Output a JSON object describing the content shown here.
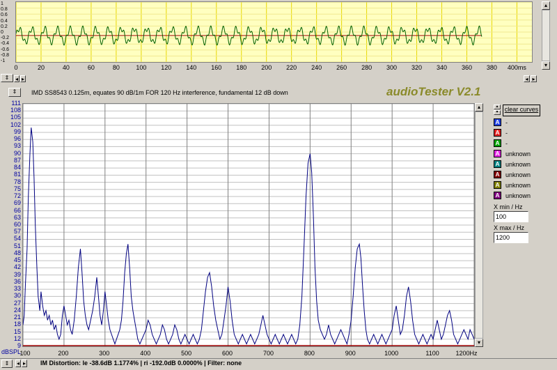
{
  "oscilloscope": {
    "y_labels": [
      "1",
      "0.8",
      "0.6",
      "0.4",
      "0.2",
      "0",
      "-0.2",
      "-0.4",
      "-0.6",
      "-0.8",
      "-1"
    ],
    "x_ticks": [
      "0",
      "20",
      "40",
      "60",
      "80",
      "100",
      "120",
      "140",
      "160",
      "180",
      "200",
      "220",
      "240",
      "260",
      "280",
      "300",
      "320",
      "340",
      "360",
      "380",
      "400ms"
    ],
    "x_max_ms": 400,
    "signal_end_ms": 372,
    "waveform_color": "#006000",
    "center_line_color": "#a00000"
  },
  "graph_title": "IMD SS8543 0.125m, equates 90 dB/1m FOR 120 Hz interference, fundamental 12 dB down",
  "app_logo": "audioTester V2.1",
  "chart_data": {
    "type": "line",
    "title": "",
    "xlabel": "Hz",
    "ylabel": "dBSPL",
    "xlim": [
      100,
      1200
    ],
    "ylim": [
      9,
      111
    ],
    "x_ticks": [
      "100",
      "200",
      "300",
      "400",
      "500",
      "600",
      "700",
      "800",
      "900",
      "1000",
      "1100",
      "1200Hz"
    ],
    "y_ticks": [
      "111",
      "108",
      "105",
      "102",
      "99",
      "96",
      "93",
      "90",
      "87",
      "84",
      "81",
      "78",
      "75",
      "72",
      "69",
      "66",
      "63",
      "60",
      "57",
      "54",
      "51",
      "48",
      "45",
      "42",
      "39",
      "36",
      "33",
      "30",
      "27",
      "24",
      "21",
      "18",
      "15",
      "12",
      "9"
    ],
    "series": [
      {
        "color": "#000080",
        "points": [
          [
            100,
            18
          ],
          [
            103,
            22
          ],
          [
            106,
            35
          ],
          [
            110,
            50
          ],
          [
            113,
            72
          ],
          [
            117,
            90
          ],
          [
            120,
            101
          ],
          [
            124,
            95
          ],
          [
            127,
            80
          ],
          [
            130,
            60
          ],
          [
            134,
            42
          ],
          [
            137,
            30
          ],
          [
            141,
            24
          ],
          [
            144,
            32
          ],
          [
            148,
            26
          ],
          [
            152,
            22
          ],
          [
            156,
            24
          ],
          [
            160,
            20
          ],
          [
            164,
            22
          ],
          [
            168,
            18
          ],
          [
            172,
            20
          ],
          [
            176,
            16
          ],
          [
            180,
            18
          ],
          [
            184,
            14
          ],
          [
            188,
            12
          ],
          [
            192,
            14
          ],
          [
            196,
            22
          ],
          [
            200,
            26
          ],
          [
            204,
            22
          ],
          [
            208,
            18
          ],
          [
            212,
            20
          ],
          [
            216,
            16
          ],
          [
            220,
            14
          ],
          [
            225,
            20
          ],
          [
            230,
            30
          ],
          [
            235,
            42
          ],
          [
            240,
            50
          ],
          [
            244,
            40
          ],
          [
            248,
            28
          ],
          [
            252,
            22
          ],
          [
            256,
            18
          ],
          [
            260,
            16
          ],
          [
            265,
            20
          ],
          [
            270,
            24
          ],
          [
            275,
            30
          ],
          [
            280,
            38
          ],
          [
            284,
            30
          ],
          [
            288,
            22
          ],
          [
            292,
            18
          ],
          [
            296,
            24
          ],
          [
            300,
            32
          ],
          [
            304,
            26
          ],
          [
            308,
            20
          ],
          [
            312,
            16
          ],
          [
            316,
            14
          ],
          [
            320,
            12
          ],
          [
            324,
            10
          ],
          [
            328,
            12
          ],
          [
            332,
            14
          ],
          [
            336,
            16
          ],
          [
            340,
            20
          ],
          [
            344,
            28
          ],
          [
            348,
            40
          ],
          [
            352,
            48
          ],
          [
            356,
            52
          ],
          [
            360,
            42
          ],
          [
            364,
            30
          ],
          [
            368,
            24
          ],
          [
            372,
            20
          ],
          [
            376,
            16
          ],
          [
            380,
            12
          ],
          [
            385,
            10
          ],
          [
            390,
            12
          ],
          [
            395,
            14
          ],
          [
            400,
            16
          ],
          [
            405,
            20
          ],
          [
            410,
            18
          ],
          [
            415,
            14
          ],
          [
            420,
            12
          ],
          [
            425,
            10
          ],
          [
            430,
            12
          ],
          [
            435,
            14
          ],
          [
            440,
            18
          ],
          [
            445,
            16
          ],
          [
            450,
            12
          ],
          [
            455,
            10
          ],
          [
            460,
            12
          ],
          [
            465,
            14
          ],
          [
            470,
            18
          ],
          [
            475,
            16
          ],
          [
            480,
            12
          ],
          [
            485,
            10
          ],
          [
            490,
            12
          ],
          [
            495,
            14
          ],
          [
            500,
            12
          ],
          [
            505,
            10
          ],
          [
            510,
            12
          ],
          [
            515,
            14
          ],
          [
            520,
            12
          ],
          [
            525,
            10
          ],
          [
            530,
            12
          ],
          [
            535,
            16
          ],
          [
            540,
            24
          ],
          [
            545,
            32
          ],
          [
            550,
            38
          ],
          [
            555,
            40
          ],
          [
            560,
            34
          ],
          [
            565,
            26
          ],
          [
            570,
            20
          ],
          [
            575,
            16
          ],
          [
            580,
            12
          ],
          [
            585,
            14
          ],
          [
            590,
            20
          ],
          [
            595,
            26
          ],
          [
            600,
            34
          ],
          [
            605,
            28
          ],
          [
            610,
            20
          ],
          [
            615,
            14
          ],
          [
            620,
            12
          ],
          [
            625,
            10
          ],
          [
            630,
            12
          ],
          [
            635,
            14
          ],
          [
            640,
            12
          ],
          [
            645,
            10
          ],
          [
            650,
            12
          ],
          [
            655,
            14
          ],
          [
            660,
            12
          ],
          [
            665,
            10
          ],
          [
            670,
            12
          ],
          [
            675,
            14
          ],
          [
            680,
            18
          ],
          [
            685,
            22
          ],
          [
            690,
            18
          ],
          [
            695,
            14
          ],
          [
            700,
            12
          ],
          [
            705,
            10
          ],
          [
            710,
            12
          ],
          [
            715,
            14
          ],
          [
            720,
            12
          ],
          [
            725,
            10
          ],
          [
            730,
            12
          ],
          [
            735,
            14
          ],
          [
            740,
            12
          ],
          [
            745,
            10
          ],
          [
            750,
            12
          ],
          [
            755,
            14
          ],
          [
            760,
            12
          ],
          [
            765,
            10
          ],
          [
            770,
            12
          ],
          [
            775,
            18
          ],
          [
            780,
            30
          ],
          [
            785,
            50
          ],
          [
            790,
            72
          ],
          [
            795,
            86
          ],
          [
            800,
            90
          ],
          [
            804,
            82
          ],
          [
            808,
            64
          ],
          [
            812,
            42
          ],
          [
            816,
            28
          ],
          [
            820,
            20
          ],
          [
            825,
            16
          ],
          [
            830,
            14
          ],
          [
            835,
            12
          ],
          [
            840,
            14
          ],
          [
            845,
            18
          ],
          [
            850,
            14
          ],
          [
            855,
            12
          ],
          [
            860,
            10
          ],
          [
            865,
            12
          ],
          [
            870,
            14
          ],
          [
            875,
            16
          ],
          [
            880,
            14
          ],
          [
            885,
            12
          ],
          [
            890,
            10
          ],
          [
            895,
            14
          ],
          [
            900,
            20
          ],
          [
            905,
            30
          ],
          [
            910,
            42
          ],
          [
            915,
            50
          ],
          [
            920,
            52
          ],
          [
            924,
            46
          ],
          [
            928,
            34
          ],
          [
            932,
            24
          ],
          [
            936,
            16
          ],
          [
            940,
            12
          ],
          [
            945,
            10
          ],
          [
            950,
            12
          ],
          [
            955,
            14
          ],
          [
            960,
            12
          ],
          [
            965,
            10
          ],
          [
            970,
            12
          ],
          [
            975,
            14
          ],
          [
            980,
            12
          ],
          [
            985,
            10
          ],
          [
            990,
            12
          ],
          [
            995,
            14
          ],
          [
            1000,
            16
          ],
          [
            1005,
            22
          ],
          [
            1010,
            26
          ],
          [
            1015,
            20
          ],
          [
            1020,
            14
          ],
          [
            1025,
            16
          ],
          [
            1030,
            22
          ],
          [
            1035,
            30
          ],
          [
            1040,
            34
          ],
          [
            1045,
            28
          ],
          [
            1050,
            20
          ],
          [
            1055,
            14
          ],
          [
            1060,
            12
          ],
          [
            1065,
            10
          ],
          [
            1070,
            12
          ],
          [
            1075,
            14
          ],
          [
            1080,
            12
          ],
          [
            1085,
            10
          ],
          [
            1090,
            12
          ],
          [
            1095,
            14
          ],
          [
            1100,
            12
          ],
          [
            1105,
            16
          ],
          [
            1110,
            20
          ],
          [
            1115,
            16
          ],
          [
            1120,
            12
          ],
          [
            1125,
            14
          ],
          [
            1130,
            18
          ],
          [
            1135,
            22
          ],
          [
            1140,
            24
          ],
          [
            1145,
            20
          ],
          [
            1150,
            14
          ],
          [
            1155,
            12
          ],
          [
            1160,
            10
          ],
          [
            1165,
            12
          ],
          [
            1170,
            14
          ],
          [
            1175,
            16
          ],
          [
            1180,
            14
          ],
          [
            1185,
            12
          ],
          [
            1190,
            16
          ],
          [
            1195,
            14
          ],
          [
            1200,
            12
          ]
        ]
      }
    ],
    "baseline_color": "#a00000"
  },
  "status": {
    "text": "IM Distortion: le -38.6dB 1.1774% | ri -192.0dB 0.0000% |   Filter: none"
  },
  "panel": {
    "clear_label": "clear curves",
    "legend": [
      {
        "letter": "A",
        "color": "#2040e0",
        "name": "-"
      },
      {
        "letter": "A",
        "color": "#e02020",
        "name": "-"
      },
      {
        "letter": "A",
        "color": "#00a000",
        "name": "-"
      },
      {
        "letter": "A",
        "color": "#e020e0",
        "name": "unknown"
      },
      {
        "letter": "A",
        "color": "#008080",
        "name": "unknown"
      },
      {
        "letter": "A",
        "color": "#800000",
        "name": "unknown"
      },
      {
        "letter": "A",
        "color": "#808000",
        "name": "unknown"
      },
      {
        "letter": "A",
        "color": "#800080",
        "name": "unknown"
      }
    ],
    "x_min_label": "X min / Hz",
    "x_min_value": "100",
    "x_max_label": "X max / Hz",
    "x_max_value": "1200"
  }
}
